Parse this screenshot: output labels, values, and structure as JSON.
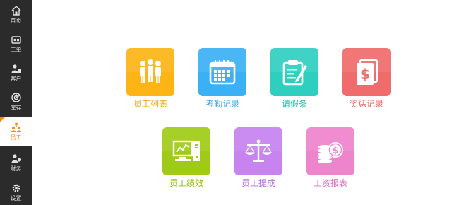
{
  "sidebar": {
    "items": [
      {
        "label": "首页",
        "icon": "home-icon"
      },
      {
        "label": "工单",
        "icon": "ticket-icon"
      },
      {
        "label": "客户",
        "icon": "customer-icon"
      },
      {
        "label": "库存",
        "icon": "inventory-icon"
      },
      {
        "label": "员工",
        "icon": "staff-icon",
        "active": true
      },
      {
        "label": "财务",
        "icon": "finance-icon"
      },
      {
        "label": "设置",
        "icon": "gear-icon"
      }
    ],
    "active_color": "#f08c1a"
  },
  "tiles": [
    {
      "label": "员工列表",
      "icon": "people-icon",
      "color": "#fdb515",
      "text_color": "#f4a516"
    },
    {
      "label": "考勤记录",
      "icon": "calendar-icon",
      "color": "#3bb0f5",
      "text_color": "#3aa6ee"
    },
    {
      "label": "请假条",
      "icon": "note-icon",
      "color": "#2fcfc0",
      "text_color": "#22b8aa"
    },
    {
      "label": "奖惩记录",
      "icon": "dollar-book-icon",
      "color": "#f06b6b",
      "text_color": "#e95e5e"
    },
    {
      "label": "员工绩效",
      "icon": "chart-monitor-icon",
      "color": "#9fcb16",
      "text_color": "#8fbe12"
    },
    {
      "label": "员工提成",
      "icon": "scale-icon",
      "color": "#c783f0",
      "text_color": "#b46fe6"
    },
    {
      "label": "工资报表",
      "icon": "coins-icon",
      "color": "#ee84cc",
      "text_color": "#e06ec0"
    }
  ]
}
